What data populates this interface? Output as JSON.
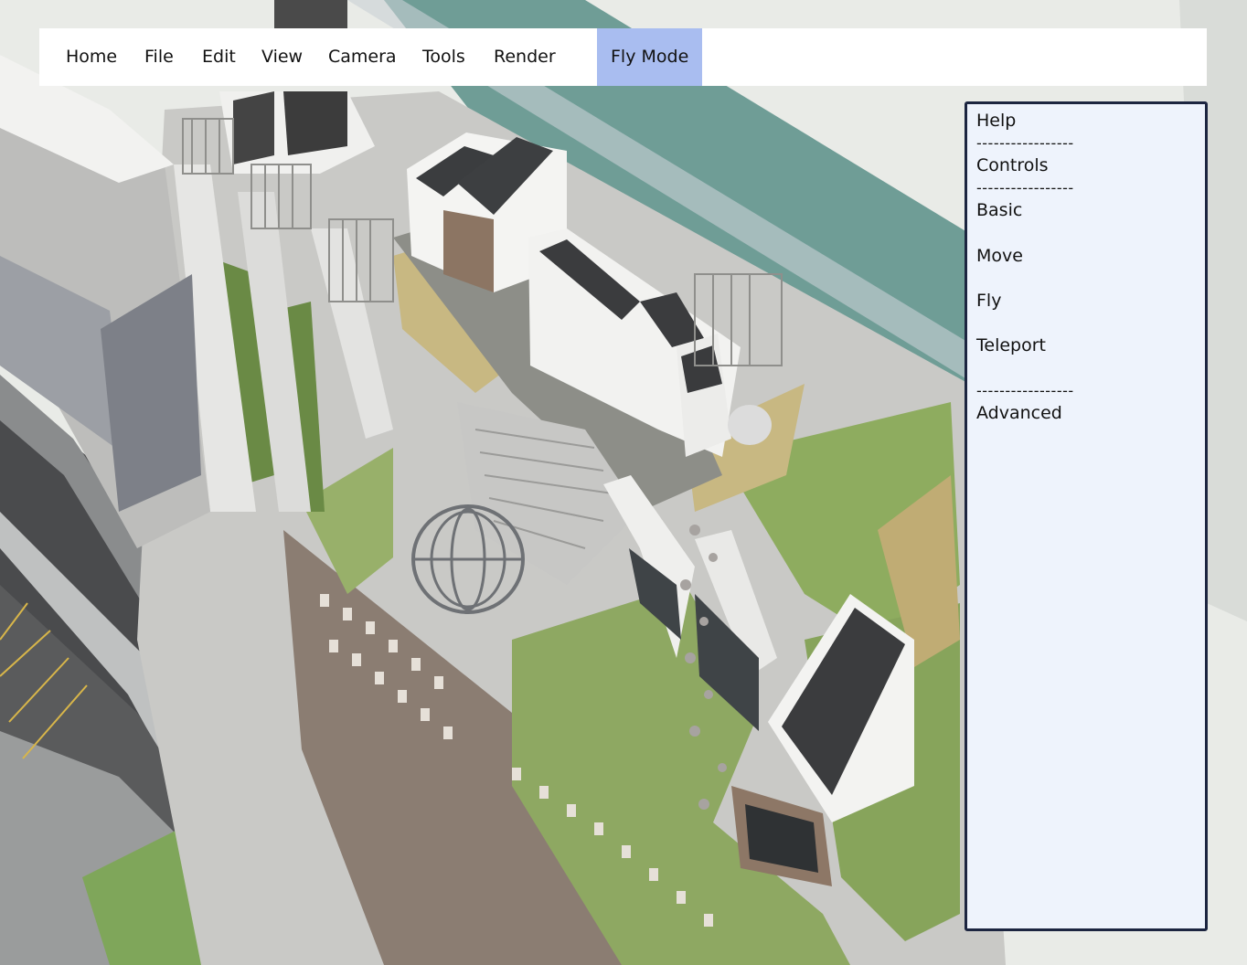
{
  "menubar": {
    "items": [
      {
        "label": "Home"
      },
      {
        "label": "File"
      },
      {
        "label": "Edit"
      },
      {
        "label": "View"
      },
      {
        "label": "Camera"
      },
      {
        "label": "Tools"
      },
      {
        "label": "Render"
      }
    ],
    "mode_button": {
      "label": "Fly Mode",
      "active": true
    }
  },
  "help_panel": {
    "title": "Help",
    "separator": "-----------------",
    "sections": [
      {
        "label": "Controls"
      },
      {
        "label": "Basic"
      },
      {
        "label": "Move"
      },
      {
        "label": "Fly"
      },
      {
        "label": "Teleport"
      },
      {
        "label": "Advanced"
      }
    ]
  },
  "colors": {
    "menubar_bg": "#ffffff",
    "active_mode_bg": "#a9bdf0",
    "panel_bg": "#eef3fc",
    "panel_border": "#1c2540"
  }
}
